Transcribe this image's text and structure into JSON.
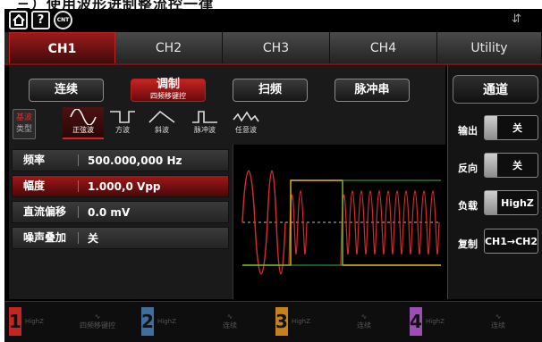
{
  "top_strip": {
    "text": "三）使用波形进制整流控一律"
  },
  "status_bar": {
    "home_icon": "home-icon",
    "help_label": "?",
    "cnt_label": "CNT",
    "usb_icon": "usb-icon"
  },
  "channel_tabs": [
    {
      "label": "CH1",
      "active": true
    },
    {
      "label": "CH2",
      "active": false
    },
    {
      "label": "CH3",
      "active": false
    },
    {
      "label": "CH4",
      "active": false
    },
    {
      "label": "Utility",
      "active": false
    }
  ],
  "mode_buttons": [
    {
      "label": "连续",
      "sub": ""
    },
    {
      "label": "调制",
      "sub": "四频移键控"
    },
    {
      "label": "扫频",
      "sub": ""
    },
    {
      "label": "脉冲串",
      "sub": ""
    }
  ],
  "wave_type": {
    "line1": "基波",
    "line2": "类型"
  },
  "waveforms": [
    {
      "label": "正弦波",
      "icon": "sine-wave-icon"
    },
    {
      "label": "方波",
      "icon": "square-wave-icon"
    },
    {
      "label": "斜波",
      "icon": "ramp-wave-icon"
    },
    {
      "label": "脉冲波",
      "icon": "pulse-wave-icon"
    },
    {
      "label": "任意波",
      "icon": "arbitrary-wave-icon"
    }
  ],
  "params": [
    {
      "name": "频率",
      "value": "500.000,000 Hz"
    },
    {
      "name": "幅度",
      "value": "1.000,0 Vpp"
    },
    {
      "name": "直流偏移",
      "value": "0.0 mV"
    },
    {
      "name": "噪声叠加",
      "value": "关"
    }
  ],
  "side_panel": {
    "title": "通道",
    "items": [
      {
        "label": "输出",
        "value": "关"
      },
      {
        "label": "反向",
        "value": "关"
      },
      {
        "label": "负载",
        "value": "HighZ"
      },
      {
        "label": "复制",
        "value": "CH1→CH2"
      }
    ]
  },
  "bottom_channels": [
    {
      "num": "1",
      "load": "HighZ",
      "mode": "四频移键控",
      "color": "#c62323"
    },
    {
      "num": "2",
      "load": "HighZ",
      "mode": "连续",
      "color": "#3f6f9f"
    },
    {
      "num": "3",
      "load": "HighZ",
      "mode": "连续",
      "color": "#c8801a"
    },
    {
      "num": "4",
      "load": "HighZ",
      "mode": "连续",
      "color": "#9b4fb0"
    }
  ],
  "colors": {
    "accent": "#c62323",
    "wave_red": "#d62a2a",
    "wave_yellow": "#e8c200",
    "wave_green": "#3fb34a"
  }
}
